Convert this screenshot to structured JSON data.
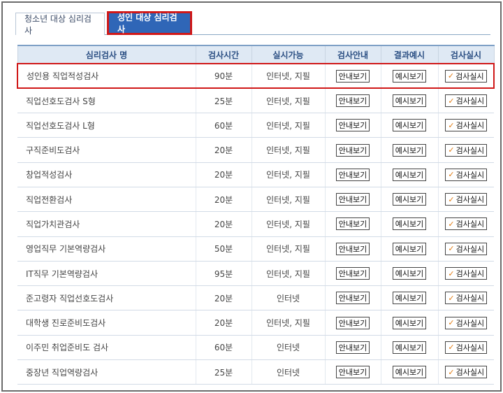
{
  "tabs": [
    {
      "label": "청소년 대상 심리검사",
      "active": false
    },
    {
      "label": "성인 대상 심리검사",
      "active": true
    }
  ],
  "table": {
    "headers": [
      "심리검사 명",
      "검사시간",
      "실시가능",
      "검사안내",
      "결과예시",
      "검사실시"
    ],
    "guide_button": "안내보기",
    "sample_button": "예시보기",
    "run_button": "검사실시",
    "rows": [
      {
        "name": "성인용 직업적성검사",
        "time": "90분",
        "mode": "인터넷, 지필",
        "highlighted": true
      },
      {
        "name": "직업선호도검사 S형",
        "time": "25분",
        "mode": "인터넷, 지필"
      },
      {
        "name": "직업선호도검사 L형",
        "time": "60분",
        "mode": "인터넷, 지필"
      },
      {
        "name": "구직준비도검사",
        "time": "20분",
        "mode": "인터넷, 지필"
      },
      {
        "name": "창업적성검사",
        "time": "20분",
        "mode": "인터넷, 지필"
      },
      {
        "name": "직업전환검사",
        "time": "20분",
        "mode": "인터넷, 지필"
      },
      {
        "name": "직업가치관검사",
        "time": "20분",
        "mode": "인터넷, 지필"
      },
      {
        "name": "영업직무 기본역량검사",
        "time": "50분",
        "mode": "인터넷, 지필"
      },
      {
        "name": "IT직무 기본역량검사",
        "time": "95분",
        "mode": "인터넷, 지필"
      },
      {
        "name": "준고령자 직업선호도검사",
        "time": "20분",
        "mode": "인터넷"
      },
      {
        "name": "대학생 진로준비도검사",
        "time": "20분",
        "mode": "인터넷, 지필"
      },
      {
        "name": "이주민 취업준비도 검사",
        "time": "60분",
        "mode": "인터넷"
      },
      {
        "name": "중장년 직업역량검사",
        "time": "25분",
        "mode": "인터넷"
      }
    ]
  },
  "icons": {
    "run_check": "checkmark-icon"
  },
  "colors": {
    "active_tab": "#2f66b7",
    "highlight": "#d01818",
    "check": "#e07b13",
    "header_bg": "#dfe9f4"
  }
}
